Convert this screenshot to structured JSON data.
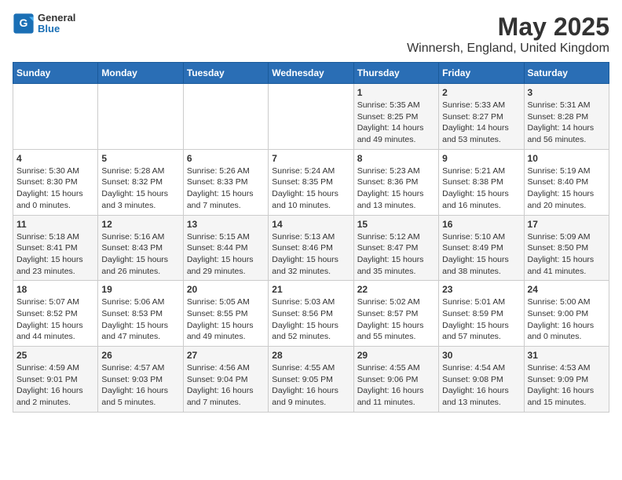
{
  "logo": {
    "general": "General",
    "blue": "Blue"
  },
  "title": "May 2025",
  "subtitle": "Winnersh, England, United Kingdom",
  "weekdays": [
    "Sunday",
    "Monday",
    "Tuesday",
    "Wednesday",
    "Thursday",
    "Friday",
    "Saturday"
  ],
  "weeks": [
    [
      {
        "day": "",
        "info": ""
      },
      {
        "day": "",
        "info": ""
      },
      {
        "day": "",
        "info": ""
      },
      {
        "day": "",
        "info": ""
      },
      {
        "day": "1",
        "info": "Sunrise: 5:35 AM\nSunset: 8:25 PM\nDaylight: 14 hours\nand 49 minutes."
      },
      {
        "day": "2",
        "info": "Sunrise: 5:33 AM\nSunset: 8:27 PM\nDaylight: 14 hours\nand 53 minutes."
      },
      {
        "day": "3",
        "info": "Sunrise: 5:31 AM\nSunset: 8:28 PM\nDaylight: 14 hours\nand 56 minutes."
      }
    ],
    [
      {
        "day": "4",
        "info": "Sunrise: 5:30 AM\nSunset: 8:30 PM\nDaylight: 15 hours\nand 0 minutes."
      },
      {
        "day": "5",
        "info": "Sunrise: 5:28 AM\nSunset: 8:32 PM\nDaylight: 15 hours\nand 3 minutes."
      },
      {
        "day": "6",
        "info": "Sunrise: 5:26 AM\nSunset: 8:33 PM\nDaylight: 15 hours\nand 7 minutes."
      },
      {
        "day": "7",
        "info": "Sunrise: 5:24 AM\nSunset: 8:35 PM\nDaylight: 15 hours\nand 10 minutes."
      },
      {
        "day": "8",
        "info": "Sunrise: 5:23 AM\nSunset: 8:36 PM\nDaylight: 15 hours\nand 13 minutes."
      },
      {
        "day": "9",
        "info": "Sunrise: 5:21 AM\nSunset: 8:38 PM\nDaylight: 15 hours\nand 16 minutes."
      },
      {
        "day": "10",
        "info": "Sunrise: 5:19 AM\nSunset: 8:40 PM\nDaylight: 15 hours\nand 20 minutes."
      }
    ],
    [
      {
        "day": "11",
        "info": "Sunrise: 5:18 AM\nSunset: 8:41 PM\nDaylight: 15 hours\nand 23 minutes."
      },
      {
        "day": "12",
        "info": "Sunrise: 5:16 AM\nSunset: 8:43 PM\nDaylight: 15 hours\nand 26 minutes."
      },
      {
        "day": "13",
        "info": "Sunrise: 5:15 AM\nSunset: 8:44 PM\nDaylight: 15 hours\nand 29 minutes."
      },
      {
        "day": "14",
        "info": "Sunrise: 5:13 AM\nSunset: 8:46 PM\nDaylight: 15 hours\nand 32 minutes."
      },
      {
        "day": "15",
        "info": "Sunrise: 5:12 AM\nSunset: 8:47 PM\nDaylight: 15 hours\nand 35 minutes."
      },
      {
        "day": "16",
        "info": "Sunrise: 5:10 AM\nSunset: 8:49 PM\nDaylight: 15 hours\nand 38 minutes."
      },
      {
        "day": "17",
        "info": "Sunrise: 5:09 AM\nSunset: 8:50 PM\nDaylight: 15 hours\nand 41 minutes."
      }
    ],
    [
      {
        "day": "18",
        "info": "Sunrise: 5:07 AM\nSunset: 8:52 PM\nDaylight: 15 hours\nand 44 minutes."
      },
      {
        "day": "19",
        "info": "Sunrise: 5:06 AM\nSunset: 8:53 PM\nDaylight: 15 hours\nand 47 minutes."
      },
      {
        "day": "20",
        "info": "Sunrise: 5:05 AM\nSunset: 8:55 PM\nDaylight: 15 hours\nand 49 minutes."
      },
      {
        "day": "21",
        "info": "Sunrise: 5:03 AM\nSunset: 8:56 PM\nDaylight: 15 hours\nand 52 minutes."
      },
      {
        "day": "22",
        "info": "Sunrise: 5:02 AM\nSunset: 8:57 PM\nDaylight: 15 hours\nand 55 minutes."
      },
      {
        "day": "23",
        "info": "Sunrise: 5:01 AM\nSunset: 8:59 PM\nDaylight: 15 hours\nand 57 minutes."
      },
      {
        "day": "24",
        "info": "Sunrise: 5:00 AM\nSunset: 9:00 PM\nDaylight: 16 hours\nand 0 minutes."
      }
    ],
    [
      {
        "day": "25",
        "info": "Sunrise: 4:59 AM\nSunset: 9:01 PM\nDaylight: 16 hours\nand 2 minutes."
      },
      {
        "day": "26",
        "info": "Sunrise: 4:57 AM\nSunset: 9:03 PM\nDaylight: 16 hours\nand 5 minutes."
      },
      {
        "day": "27",
        "info": "Sunrise: 4:56 AM\nSunset: 9:04 PM\nDaylight: 16 hours\nand 7 minutes."
      },
      {
        "day": "28",
        "info": "Sunrise: 4:55 AM\nSunset: 9:05 PM\nDaylight: 16 hours\nand 9 minutes."
      },
      {
        "day": "29",
        "info": "Sunrise: 4:55 AM\nSunset: 9:06 PM\nDaylight: 16 hours\nand 11 minutes."
      },
      {
        "day": "30",
        "info": "Sunrise: 4:54 AM\nSunset: 9:08 PM\nDaylight: 16 hours\nand 13 minutes."
      },
      {
        "day": "31",
        "info": "Sunrise: 4:53 AM\nSunset: 9:09 PM\nDaylight: 16 hours\nand 15 minutes."
      }
    ]
  ]
}
